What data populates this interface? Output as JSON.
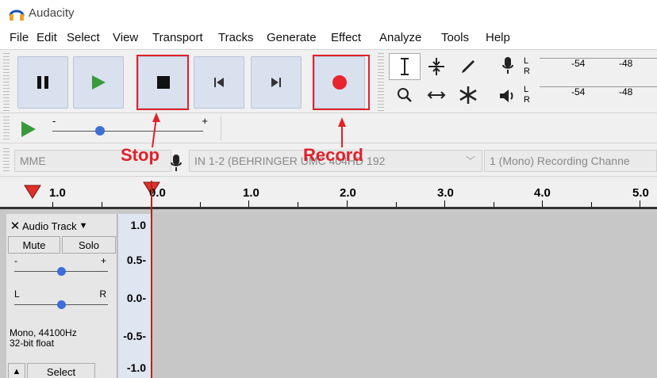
{
  "app": {
    "title": "Audacity"
  },
  "menu": [
    "File",
    "Edit",
    "Select",
    "View",
    "Transport",
    "Tracks",
    "Generate",
    "Effect",
    "Analyze",
    "Tools",
    "Help"
  ],
  "meters": {
    "record": {
      "l": "L",
      "r": "R",
      "ticks": [
        "-54",
        "-48"
      ]
    },
    "playback": {
      "l": "L",
      "r": "R",
      "ticks": [
        "-54",
        "-48"
      ]
    }
  },
  "speed": {
    "minus": "-",
    "plus": "+"
  },
  "devices": {
    "host": "MME",
    "input": "IN 1-2 (BEHRINGER UMC 404HD 192",
    "channels": "1 (Mono) Recording Channe"
  },
  "ruler": {
    "labels": [
      "1.0",
      "0.0",
      "1.0",
      "2.0",
      "3.0",
      "4.0",
      "5.0"
    ]
  },
  "track": {
    "name": "Audio Track",
    "mute": "Mute",
    "solo": "Solo",
    "gain_minus": "-",
    "gain_plus": "+",
    "pan_left": "L",
    "pan_right": "R",
    "info_line1": "Mono, 44100Hz",
    "info_line2": "32-bit float",
    "select": "Select",
    "scale": [
      "1.0",
      "0.5-",
      "0.0-",
      "-0.5-",
      "-1.0"
    ]
  },
  "annotations": {
    "stop": "Stop",
    "record": "Record"
  },
  "colors": {
    "accent": "#e0202a",
    "button_bg": "#d9e1ef",
    "play_green": "#3a9a3a",
    "record_red": "#e8242c",
    "cursor": "#b5251f"
  }
}
